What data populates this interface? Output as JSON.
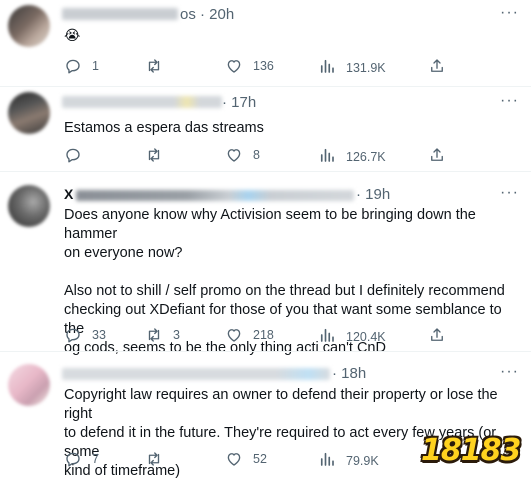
{
  "tweets": [
    {
      "time": "os · 20h",
      "text": "",
      "emoji": "😭",
      "replies": "1",
      "retweets": "",
      "likes": "136",
      "views": "131.9K"
    },
    {
      "time": "· 17h",
      "text": "Estamos a espera das streams",
      "replies": "",
      "retweets": "",
      "likes": "8",
      "views": "126.7K"
    },
    {
      "time": "· 19h",
      "name_fragment": "X",
      "text": "Does anyone know why Activision seem to be bringing down the hammer\non everyone now?\n\nAlso not to shill / self promo on the thread but I definitely recommend\nchecking out XDefiant for those of you that want some semblance to the\nog cods, seems to be the only thing acti can't CnD",
      "replies": "33",
      "retweets": "3",
      "likes": "218",
      "views": "120.4K"
    },
    {
      "time": "· 18h",
      "text": "Copyright law requires an owner to defend their property or lose the right\nto defend it in the future. They're required to act every few years (or some\nkind of timeframe)",
      "replies": "7",
      "retweets": "",
      "likes": "52",
      "views": "79.9K"
    }
  ],
  "icons": {
    "reply": "reply-icon",
    "retweet": "retweet-icon",
    "like": "heart-icon",
    "views": "views-icon",
    "share": "share-icon"
  },
  "watermark": "18183",
  "colors": {
    "text": "#0f1419",
    "muted": "#536471",
    "divider": "#eff3f4",
    "watermark": "#ffd21f"
  }
}
